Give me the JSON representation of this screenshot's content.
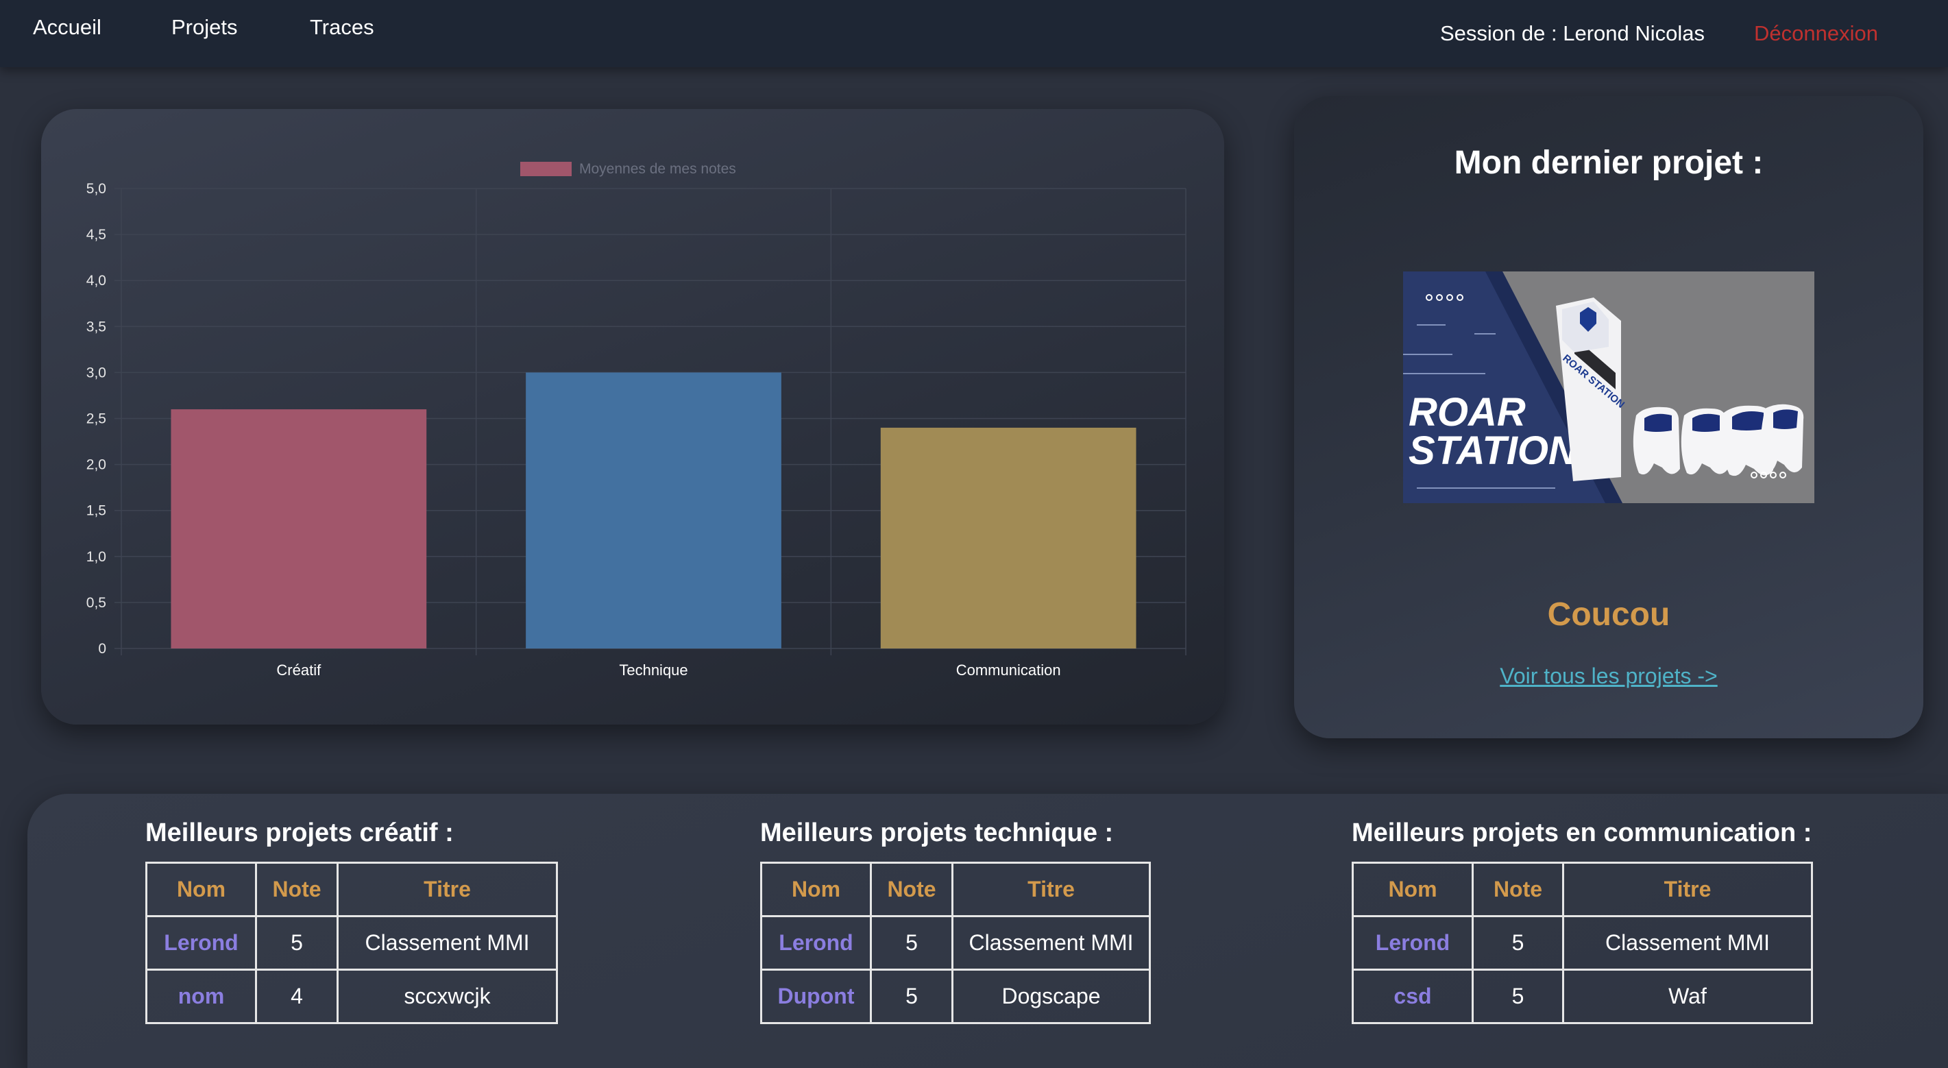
{
  "nav": {
    "links": [
      "Accueil",
      "Projets",
      "Traces"
    ],
    "session": "Session de : Lerond Nicolas",
    "logout": "Déconnexion",
    "logout_color": "#c0312f"
  },
  "chart_data": {
    "type": "bar",
    "categories": [
      "Créatif",
      "Technique",
      "Communication"
    ],
    "series": [
      {
        "name": "Moyennes de mes notes",
        "values": [
          2.6,
          3.0,
          2.4
        ],
        "colors": [
          "#a1566b",
          "#4371a0",
          "#a18b55"
        ]
      }
    ],
    "ylim": [
      0,
      5
    ],
    "yticks": [
      "0",
      "0,5",
      "1,0",
      "1,5",
      "2,0",
      "2,5",
      "3,0",
      "3,5",
      "4,0",
      "4,5",
      "5,0"
    ],
    "grid": true,
    "legend": "top-center"
  },
  "project": {
    "heading": "Mon dernier projet :",
    "image_text": [
      "ROAR",
      "STATION"
    ],
    "console_label": "ROAR STATION",
    "name": "Coucou",
    "link": "Voir tous les projets ->"
  },
  "tables": [
    {
      "title": "Meilleurs projets créatif :",
      "headers": [
        "Nom",
        "Note",
        "Titre"
      ],
      "rows": [
        [
          "Lerond",
          "5",
          "Classement MMI"
        ],
        [
          "nom",
          "4",
          "sccxwcjk"
        ]
      ]
    },
    {
      "title": "Meilleurs projets technique :",
      "headers": [
        "Nom",
        "Note",
        "Titre"
      ],
      "rows": [
        [
          "Lerond",
          "5",
          "Classement MMI"
        ],
        [
          "Dupont",
          "5",
          "Dogscape"
        ]
      ]
    },
    {
      "title": "Meilleurs projets en communication :",
      "headers": [
        "Nom",
        "Note",
        "Titre"
      ],
      "rows": [
        [
          "Lerond",
          "5",
          "Classement MMI"
        ],
        [
          "csd",
          "5",
          "Waf"
        ]
      ]
    }
  ]
}
